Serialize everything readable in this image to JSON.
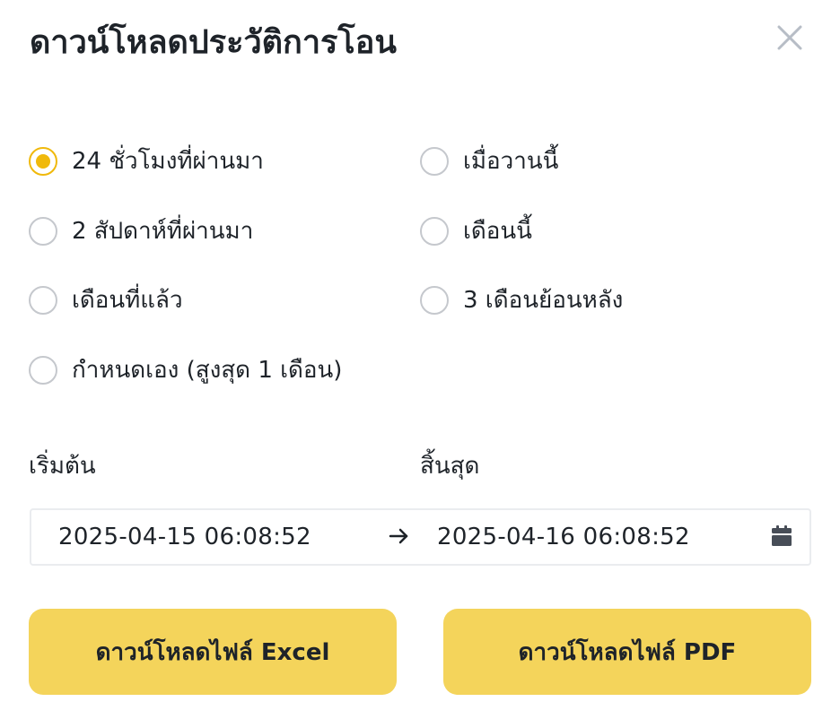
{
  "dialog": {
    "title": "ดาวน์โหลดประวัติการโอน",
    "close_icon": "close-icon"
  },
  "range_options": [
    {
      "label": "24 ชั่วโมงที่ผ่านมา",
      "selected": true
    },
    {
      "label": "เมื่อวานนี้",
      "selected": false
    },
    {
      "label": "2 สัปดาห์ที่ผ่านมา",
      "selected": false
    },
    {
      "label": "เดือนนี้",
      "selected": false
    },
    {
      "label": "เดือนที่แล้ว",
      "selected": false
    },
    {
      "label": "3 เดือนย้อนหลัง",
      "selected": false
    },
    {
      "label": "กำหนดเอง (สูงสุด 1 เดือน)",
      "selected": false
    }
  ],
  "date_range": {
    "start_label": "เริ่มต้น",
    "end_label": "สิ้นสุด",
    "start_value": "2025-04-15 06:08:52",
    "end_value": "2025-04-16 06:08:52",
    "separator_icon": "arrow-right-icon",
    "calendar_icon": "calendar-icon"
  },
  "buttons": {
    "excel_label": "ดาวน์โหลดไฟล์ Excel",
    "pdf_label": "ดาวน์โหลดไฟล์ PDF"
  },
  "colors": {
    "accent": "#f0b90b",
    "button_bg": "#f4d45b",
    "text": "#1e2329",
    "radio_border": "#c5c8cd",
    "input_border": "#eaecef"
  }
}
